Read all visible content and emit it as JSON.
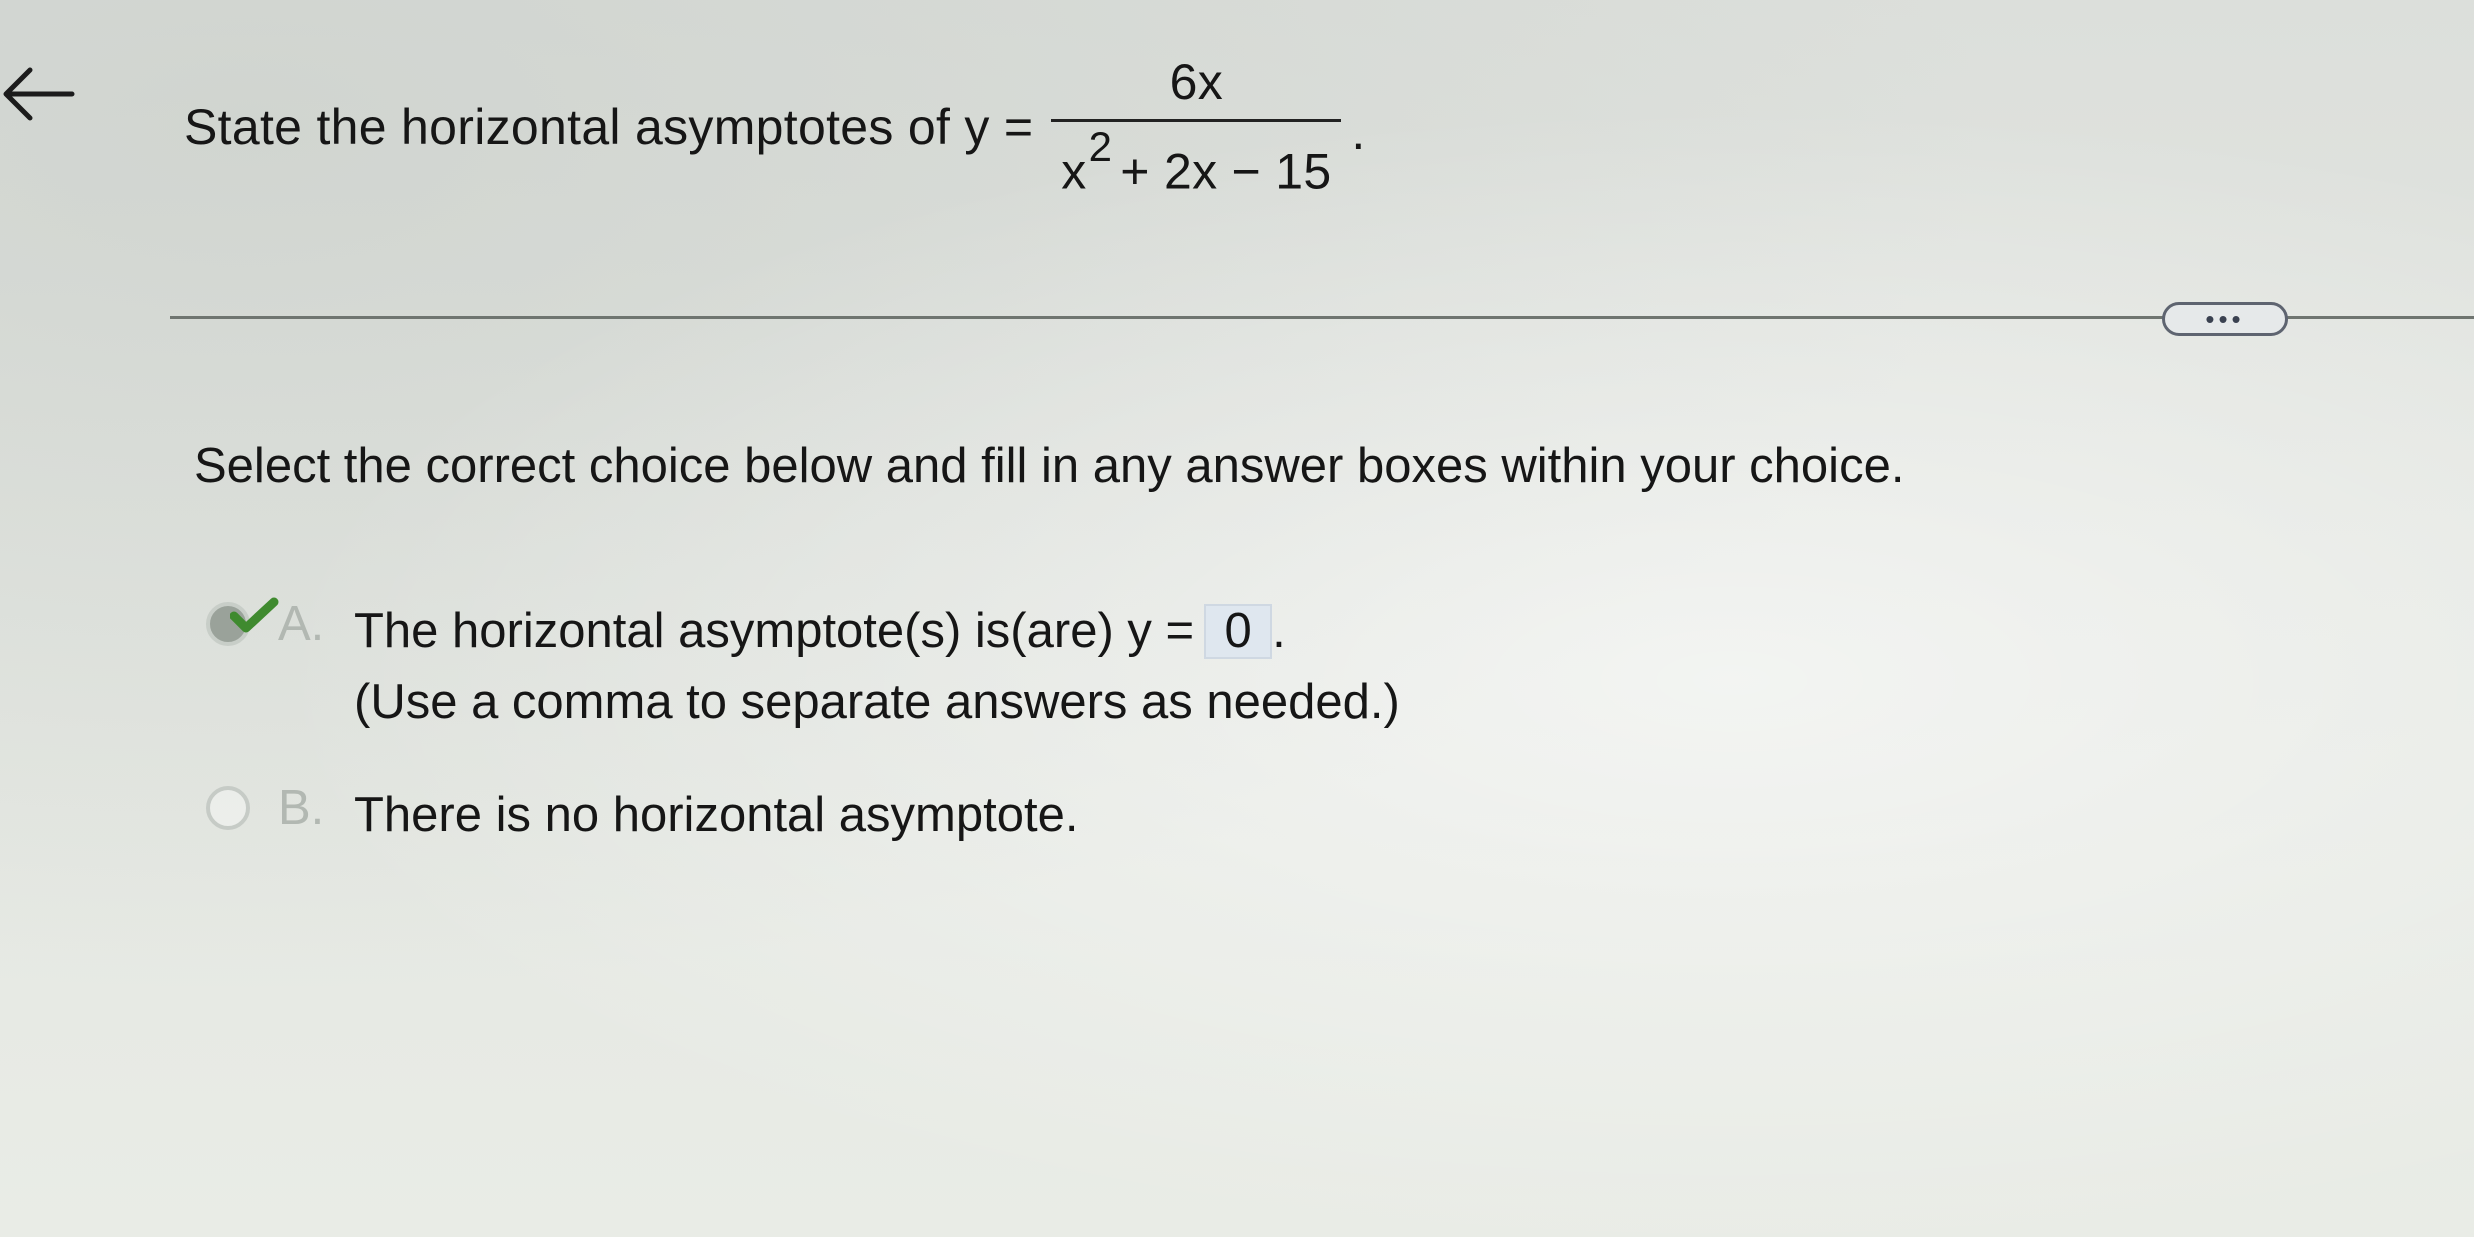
{
  "question": {
    "lead": "State the horizontal asymptotes of y =",
    "numerator": "6x",
    "denominator_base": "x",
    "denominator_exponent": "2",
    "denominator_rest": "+ 2x − 15",
    "end": "."
  },
  "more_button": {
    "label": "•••"
  },
  "instruction": "Select the correct choice below and fill in any answer boxes within your choice.",
  "choices": [
    {
      "letter": "A.",
      "text_before": "The horizontal asymptote(s) is(are) y =",
      "answer": "0",
      "text_after": ".",
      "hint": "(Use a comma to separate answers as needed.)",
      "selected": true
    },
    {
      "letter": "B.",
      "text": "There is no horizontal asymptote.",
      "selected": false
    }
  ],
  "colors": {
    "check": "#3f8a2f",
    "answer_box_bg": "#dfe7ef",
    "divider": "#6f7570"
  },
  "icons": {
    "back": "arrow-left-icon",
    "correct": "checkmark-icon"
  }
}
